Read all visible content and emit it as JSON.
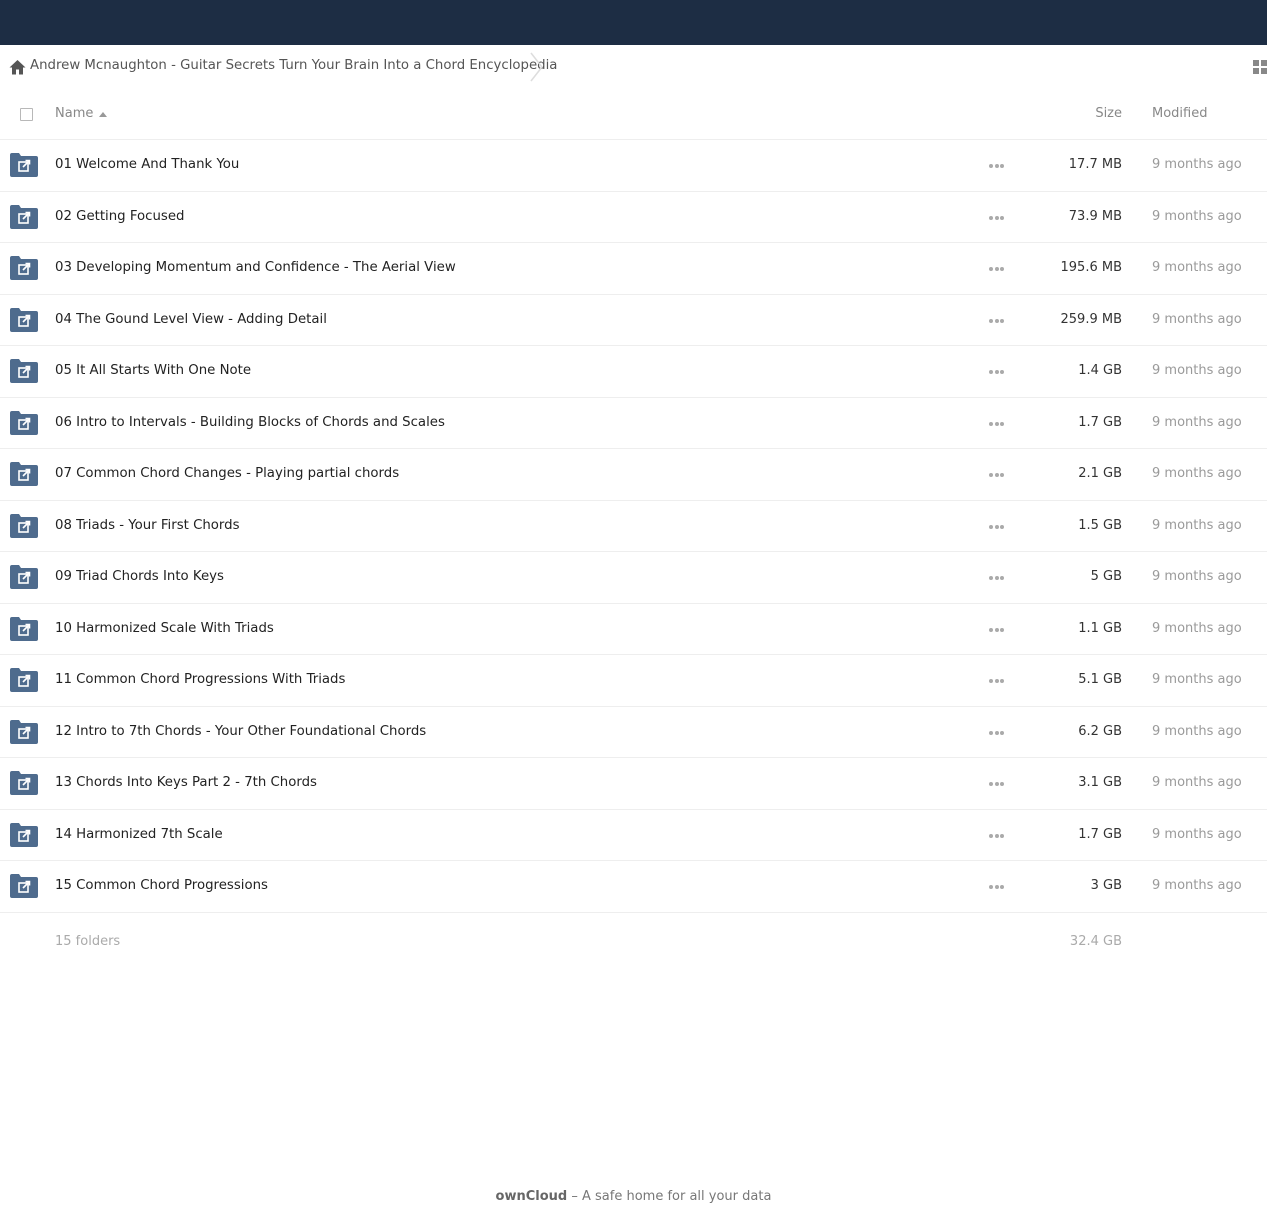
{
  "breadcrumb": {
    "home_icon": "home-icon",
    "current": "Andrew Mcnaughton - Guitar Secrets Turn Your Brain Into a Chord Encyclopedia"
  },
  "view_toggle_icon": "grid-view-icon",
  "table": {
    "columns": {
      "name": "Name",
      "size": "Size",
      "modified": "Modified"
    },
    "rows": [
      {
        "name": "01 Welcome And Thank You",
        "size": "17.7 MB",
        "modified": "9 months ago"
      },
      {
        "name": "02 Getting Focused",
        "size": "73.9 MB",
        "modified": "9 months ago"
      },
      {
        "name": "03 Developing Momentum and Confidence - The Aerial View",
        "size": "195.6 MB",
        "modified": "9 months ago"
      },
      {
        "name": "04 The Gound Level View - Adding Detail",
        "size": "259.9 MB",
        "modified": "9 months ago"
      },
      {
        "name": "05 It All Starts With One Note",
        "size": "1.4 GB",
        "modified": "9 months ago"
      },
      {
        "name": "06 Intro to Intervals - Building Blocks of Chords and Scales",
        "size": "1.7 GB",
        "modified": "9 months ago"
      },
      {
        "name": "07 Common Chord Changes - Playing partial chords",
        "size": "2.1 GB",
        "modified": "9 months ago"
      },
      {
        "name": "08 Triads - Your First Chords",
        "size": "1.5 GB",
        "modified": "9 months ago"
      },
      {
        "name": "09 Triad Chords Into Keys",
        "size": "5 GB",
        "modified": "9 months ago"
      },
      {
        "name": "10 Harmonized Scale With Triads",
        "size": "1.1 GB",
        "modified": "9 months ago"
      },
      {
        "name": "11 Common Chord Progressions With Triads",
        "size": "5.1 GB",
        "modified": "9 months ago"
      },
      {
        "name": "12 Intro to 7th Chords - Your Other Foundational Chords",
        "size": "6.2 GB",
        "modified": "9 months ago"
      },
      {
        "name": "13 Chords Into Keys Part 2 - 7th Chords",
        "size": "3.1 GB",
        "modified": "9 months ago"
      },
      {
        "name": "14 Harmonized 7th Scale",
        "size": "1.7 GB",
        "modified": "9 months ago"
      },
      {
        "name": "15 Common Chord Progressions",
        "size": "3 GB",
        "modified": "9 months ago"
      }
    ],
    "summary": {
      "count": "15 folders",
      "total_size": "32.4 GB"
    }
  },
  "footer": {
    "brand": "ownCloud",
    "tagline": " – A safe home for all your data"
  },
  "colors": {
    "header_bg": "#1d2d44",
    "folder_icon": "#4e6b8d"
  }
}
